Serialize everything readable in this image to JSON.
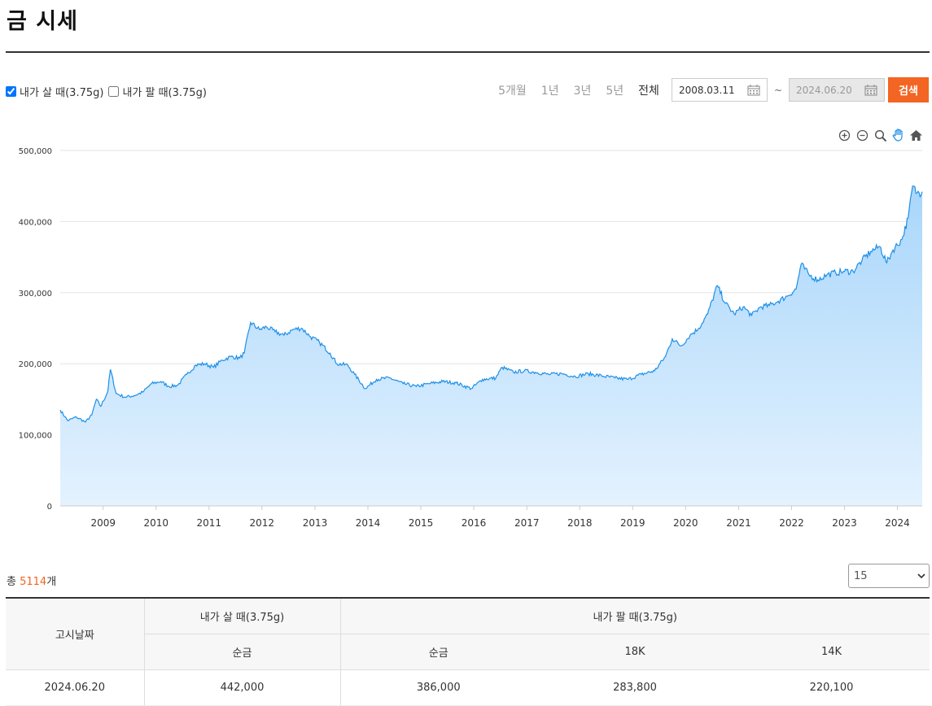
{
  "page": {
    "title": "금 시세"
  },
  "filters": {
    "buy_label": "내가 살 때(3.75g)",
    "buy_checked": true,
    "sell_label": "내가 팔 때(3.75g)",
    "sell_checked": false
  },
  "range": {
    "periods": [
      "5개월",
      "1년",
      "3년",
      "5년",
      "전체"
    ],
    "active_period": "전체",
    "start_date": "2008.03.11",
    "end_date": "2024.06.20",
    "tilde": "~",
    "search_label": "검색"
  },
  "colors": {
    "accent": "#f26522",
    "line": "#1e90e8",
    "fill_top": "#a9d6fb",
    "fill_bottom": "#e4f2fe"
  },
  "toolbar": {
    "icons": [
      "zoom-in-icon",
      "zoom-out-icon",
      "zoom-select-icon",
      "pan-hand-icon",
      "home-reset-icon"
    ]
  },
  "chart_data": {
    "type": "area",
    "title": "",
    "xlabel": "",
    "ylabel": "",
    "ylim": [
      0,
      500000
    ],
    "y_ticks": [
      0,
      100000,
      200000,
      300000,
      400000,
      500000
    ],
    "y_tick_labels": [
      "0",
      "100,000",
      "200,000",
      "300,000",
      "400,000",
      "500,000"
    ],
    "x_ticks": [
      "2009",
      "2010",
      "2011",
      "2012",
      "2013",
      "2014",
      "2015",
      "2016",
      "2017",
      "2018",
      "2019",
      "2020",
      "2021",
      "2022",
      "2023",
      "2024"
    ],
    "xlim": [
      "2008-03-11",
      "2024-06-20"
    ],
    "grid": true,
    "series": [
      {
        "x": [
          "2008-03-11",
          "2008-05-01",
          "2008-07-01",
          "2008-09-01",
          "2008-10-15",
          "2008-11-15",
          "2008-12-15",
          "2009-02-01",
          "2009-02-20",
          "2009-04-01",
          "2009-06-01",
          "2009-08-01",
          "2009-10-01",
          "2009-12-01",
          "2010-02-01",
          "2010-04-01",
          "2010-06-01",
          "2010-08-01",
          "2010-10-01",
          "2010-12-01",
          "2011-02-01",
          "2011-04-01",
          "2011-06-01",
          "2011-08-01",
          "2011-09-01",
          "2011-10-15",
          "2011-12-15",
          "2012-02-01",
          "2012-04-01",
          "2012-06-01",
          "2012-08-01",
          "2012-10-01",
          "2012-12-01",
          "2013-02-01",
          "2013-04-15",
          "2013-06-01",
          "2013-08-15",
          "2013-10-01",
          "2013-12-15",
          "2014-03-01",
          "2014-06-01",
          "2014-09-01",
          "2014-12-01",
          "2015-03-01",
          "2015-06-01",
          "2015-09-01",
          "2015-12-15",
          "2016-03-01",
          "2016-06-01",
          "2016-07-15",
          "2016-10-01",
          "2016-12-15",
          "2017-03-01",
          "2017-06-01",
          "2017-09-01",
          "2017-12-01",
          "2018-03-01",
          "2018-06-01",
          "2018-09-01",
          "2018-12-01",
          "2019-03-01",
          "2019-06-01",
          "2019-08-15",
          "2019-10-01",
          "2019-12-01",
          "2020-02-01",
          "2020-04-01",
          "2020-06-01",
          "2020-08-07",
          "2020-10-01",
          "2020-12-01",
          "2021-02-01",
          "2021-04-01",
          "2021-06-01",
          "2021-08-01",
          "2021-10-01",
          "2021-12-01",
          "2022-02-01",
          "2022-03-08",
          "2022-05-01",
          "2022-07-01",
          "2022-09-01",
          "2022-11-01",
          "2023-01-01",
          "2023-03-01",
          "2023-05-01",
          "2023-07-01",
          "2023-09-01",
          "2023-10-20",
          "2023-12-01",
          "2024-02-01",
          "2024-03-15",
          "2024-04-15",
          "2024-05-15",
          "2024-06-20"
        ],
        "values": [
          135000,
          120000,
          125000,
          118000,
          128000,
          150000,
          140000,
          160000,
          192000,
          158000,
          153000,
          155000,
          160000,
          172000,
          175000,
          168000,
          170000,
          185000,
          198000,
          200000,
          195000,
          205000,
          210000,
          208000,
          215000,
          258000,
          248000,
          252000,
          245000,
          240000,
          248000,
          250000,
          238000,
          230000,
          215000,
          200000,
          198000,
          185000,
          165000,
          178000,
          180000,
          172000,
          168000,
          172000,
          175000,
          173000,
          165000,
          178000,
          180000,
          195000,
          188000,
          190000,
          188000,
          185000,
          186000,
          182000,
          186000,
          183000,
          180000,
          178000,
          185000,
          190000,
          210000,
          235000,
          225000,
          240000,
          250000,
          270000,
          310000,
          285000,
          270000,
          280000,
          268000,
          280000,
          282000,
          288000,
          295000,
          305000,
          340000,
          325000,
          318000,
          325000,
          328000,
          330000,
          330000,
          345000,
          358000,
          365000,
          342000,
          360000,
          375000,
          405000,
          450000,
          440000,
          442000
        ]
      }
    ]
  },
  "summary": {
    "prefix": "총 ",
    "count": "5114",
    "suffix": "개"
  },
  "page_size": {
    "selected": "15"
  },
  "table": {
    "header": {
      "date": "고시날짜",
      "buy_group": "내가 살 때(3.75g)",
      "sell_group": "내가 팔 때(3.75g)",
      "buy_pure": "순금",
      "sell_pure": "순금",
      "sell_18k": "18K",
      "sell_14k": "14K"
    },
    "rows": [
      {
        "date": "2024.06.20",
        "buy_pure": "442,000",
        "sell_pure": "386,000",
        "sell_18k": "283,800",
        "sell_14k": "220,100"
      }
    ]
  }
}
